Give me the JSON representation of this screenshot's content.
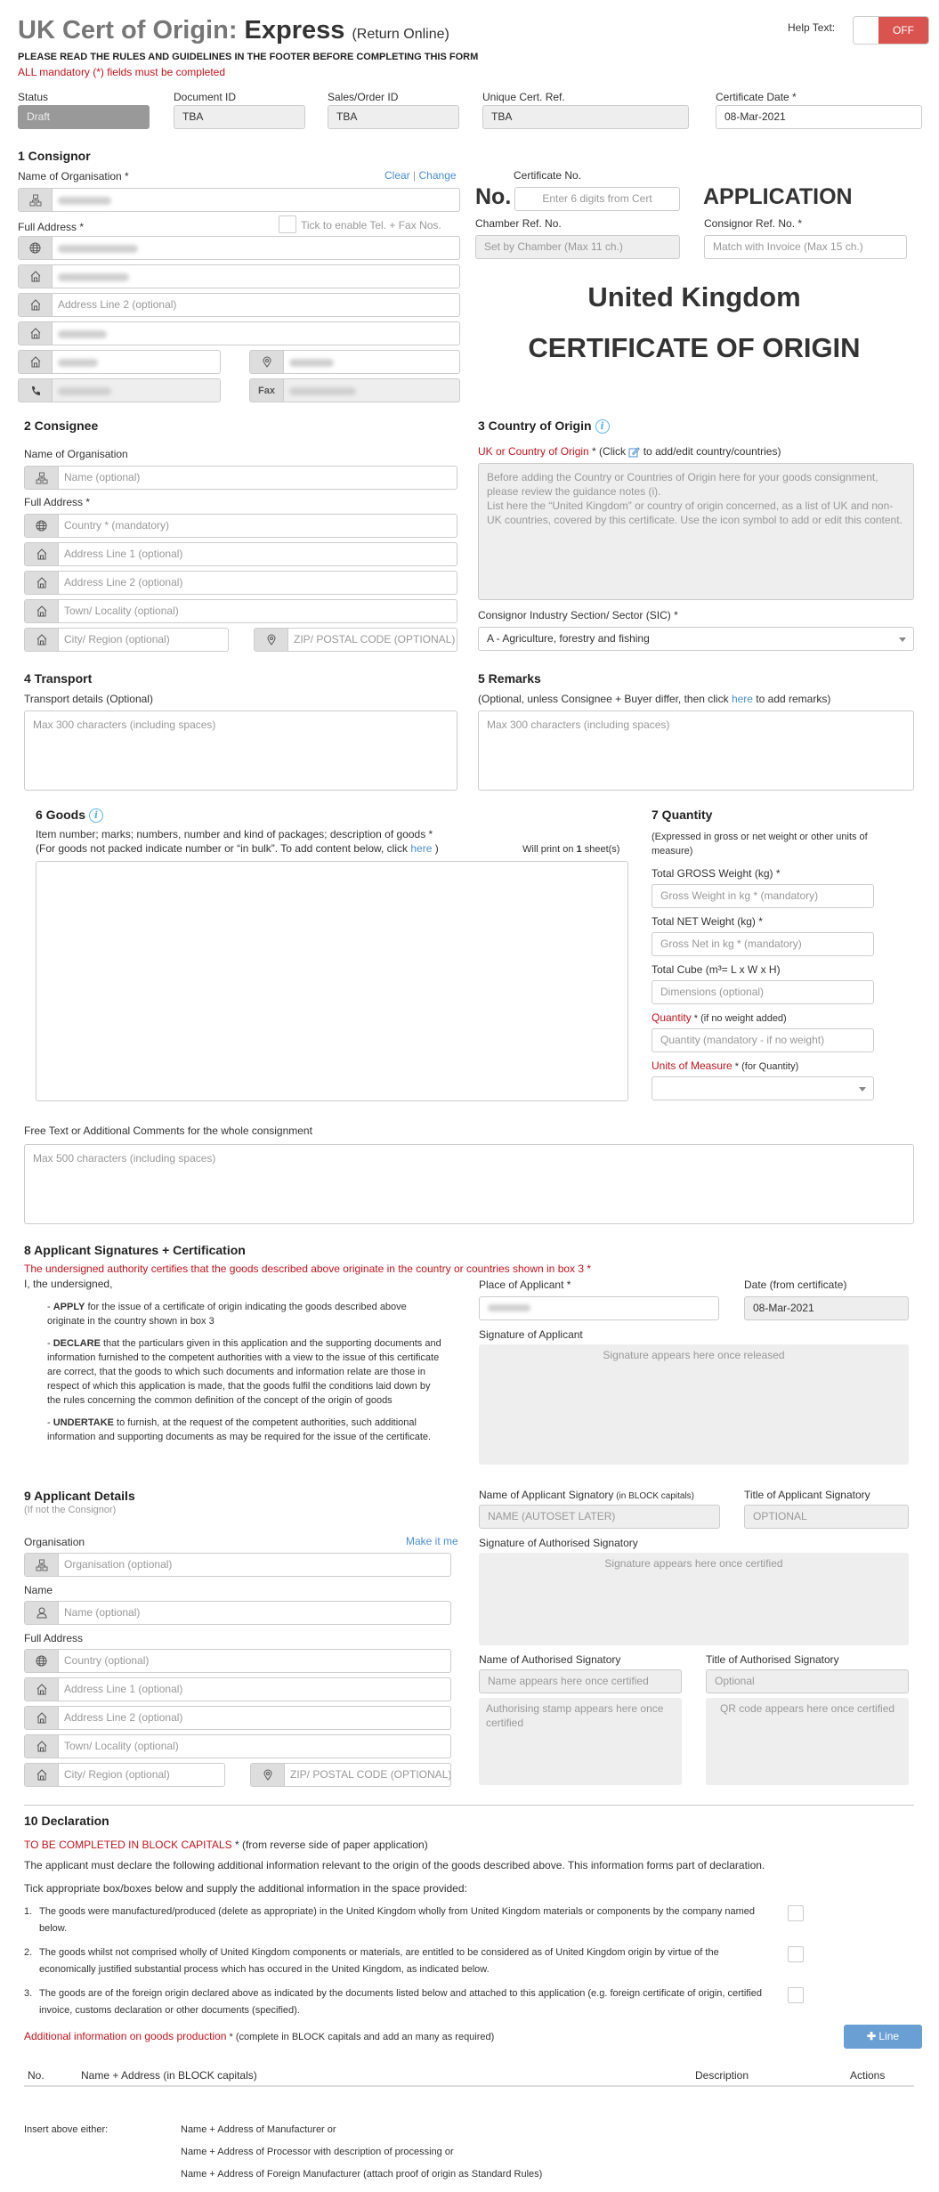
{
  "header": {
    "title_light": "UK Cert of Origin: ",
    "title_bold": "Express",
    "title_suffix": "(Return Online)",
    "notice": "PLEASE READ THE RULES AND GUIDELINES IN THE FOOTER BEFORE COMPLETING THIS FORM",
    "mandatory_note": "ALL mandatory (*) fields must be completed",
    "help_text_label": "Help Text:",
    "help_toggle_state": "OFF"
  },
  "meta_fields": [
    {
      "label": "Status",
      "value": "Draft"
    },
    {
      "label": "Document ID",
      "value": "TBA"
    },
    {
      "label": "Sales/Order ID",
      "value": "TBA"
    },
    {
      "label": "Unique Cert. Ref.",
      "value": "TBA"
    },
    {
      "label": "Certificate Date *",
      "value": "08-Mar-2021"
    }
  ],
  "consignor": {
    "heading": "1 Consignor",
    "org_label": "Name of Organisation *",
    "clear_link": "Clear",
    "separator": "|",
    "change_link": "Change",
    "address_label": "Full Address *",
    "tel_fax_checkbox_label": "Tick to enable Tel. + Fax Nos.",
    "address_line2_placeholder": "Address Line 2 (optional)",
    "fax_label": "Fax"
  },
  "certificate": {
    "cert_no_label": "Certificate No.",
    "no_prefix": "No.",
    "cert_no_placeholder": "Enter 6 digits from Cert",
    "application_heading": "APPLICATION",
    "chamber_ref_label": "Chamber Ref. No.",
    "chamber_ref_placeholder": "Set by Chamber (Max 11 ch.)",
    "consignor_ref_label": "Consignor Ref. No. *",
    "consignor_ref_placeholder": "Match with Invoice (Max 15 ch.)",
    "country_title": "United Kingdom",
    "doc_title": "CERTIFICATE OF ORIGIN"
  },
  "consignee": {
    "heading": "2 Consignee",
    "org_label": "Name of Organisation",
    "name_placeholder": "Name (optional)",
    "address_label": "Full Address *",
    "country_placeholder": "Country * (mandatory)",
    "addr1_placeholder": "Address Line 1 (optional)",
    "addr2_placeholder": "Address Line 2 (optional)",
    "town_placeholder": "Town/ Locality (optional)",
    "city_placeholder": "City/ Region (optional)",
    "zip_placeholder": "ZIP/ POSTAL CODE (OPTIONAL)"
  },
  "country_of_origin": {
    "heading": "3 Country of Origin",
    "label_red": "UK or Country of Origin",
    "label_rest_1": " * (Click ",
    "label_rest_2": " to add/edit country/countries)",
    "placeholder_p1": "Before adding the Country or Countries of Origin here for your goods consignment, please review the guidance notes (i).",
    "placeholder_p2": "List here the “United Kingdom” or country of origin concerned, as a list of UK and non-UK countries, covered by this certificate. Use the icon symbol to add or edit this content.",
    "sic_label": "Consignor Industry Section/ Sector (SIC) *",
    "sic_value": "A - Agriculture, forestry and fishing"
  },
  "transport": {
    "heading": "4 Transport",
    "label": "Transport details (Optional)",
    "placeholder": "Max 300 characters (including spaces)"
  },
  "remarks": {
    "heading": "5 Remarks",
    "label_1": "(Optional, unless Consignee + Buyer differ, then click ",
    "link": "here",
    "label_2": " to add remarks)",
    "placeholder": "Max 300 characters (including spaces)"
  },
  "goods": {
    "heading": "6 Goods",
    "label": "Item number; marks; numbers, number and kind of packages; description of goods *",
    "sublabel_1": "(For goods not packed indicate number or “in bulk”. To add content below, click ",
    "link": "here",
    "sublabel_2": " )",
    "print_prefix": "Will print on ",
    "print_sheets": "1",
    "print_suffix": " sheet(s)"
  },
  "quantity": {
    "heading": "7 Quantity",
    "note": "(Expressed in gross or net weight or other units of measure)",
    "gross_label": "Total GROSS Weight (kg) *",
    "gross_placeholder": "Gross Weight in kg * (mandatory)",
    "net_label": "Total NET Weight (kg) *",
    "net_placeholder": "Gross Net in kg * (mandatory)",
    "cube_label": "Total Cube (m³= L x W x H)",
    "cube_placeholder": "Dimensions (optional)",
    "qty_label_red": "Quantity",
    "qty_label_rest": " * (if no weight added)",
    "qty_placeholder": "Quantity (mandatory - if no weight)",
    "uom_label_red": "Units of Measure",
    "uom_label_rest": " * (for Quantity)",
    "uom_value": ""
  },
  "free_text": {
    "label": "Free Text or Additional Comments for the whole consignment",
    "placeholder": "Max 500 characters (including spaces)"
  },
  "certification": {
    "heading": "8 Applicant Signatures + Certification",
    "statement": "The undersigned authority certifies that the goods described above originate in the country or countries shown in box 3 *",
    "intro": "I, the undersigned,",
    "clauses": [
      {
        "keyword": "APPLY",
        "text": " for the issue of a certificate of origin indicating the goods described above originate in the country shown in box 3"
      },
      {
        "keyword": "DECLARE",
        "text": " that the particulars given in this application and the supporting documents and information furnished to the competent authorities with a view to the issue of this certificate are correct, that the goods to which such documents and information relate are those in respect of which this application is made, that the goods fulfil the conditions laid down by the rules concerning the common definition of the concept of the origin of goods"
      },
      {
        "keyword": "UNDERTAKE",
        "text": " to furnish, at the request of the competent authorities, such additional information and supporting documents as may be required for the issue of the certificate."
      }
    ],
    "place_label": "Place of Applicant *",
    "date_label": "Date (from certificate)",
    "date_value": "08-Mar-2021",
    "signature_label": "Signature of Applicant",
    "signature_placeholder": "Signature appears here once released"
  },
  "applicant": {
    "heading": "9 Applicant Details",
    "subheading": "(If not the Consignor)",
    "org_label": "Organisation",
    "make_it_me": "Make it me",
    "org_placeholder": "Organisation (optional)",
    "name_label": "Name",
    "name_placeholder": "Name (optional)",
    "address_label": "Full Address",
    "country_placeholder": "Country (optional)",
    "addr1_placeholder": "Address Line 1 (optional)",
    "addr2_placeholder": "Address Line 2 (optional)",
    "town_placeholder": "Town/ Locality (optional)",
    "city_placeholder": "City/ Region (optional)",
    "zip_placeholder": "ZIP/ POSTAL CODE (OPTIONAL)",
    "signatory_name_label": "Name of Applicant Signatory",
    "signatory_name_hint": " (in BLOCK capitals)",
    "signatory_name_placeholder": "NAME (AUTOSET LATER)",
    "signatory_title_label": "Title of Applicant Signatory",
    "signatory_title_placeholder": "OPTIONAL",
    "auth_signature_label": "Signature of Authorised Signatory",
    "auth_signature_placeholder": "Signature appears here once certified",
    "auth_name_label": "Name of Authorised Signatory",
    "auth_name_placeholder": "Name appears here once certified",
    "auth_title_label": "Title of Authorised Signatory",
    "auth_title_placeholder": "Optional",
    "stamp_placeholder": "Authorising stamp appears here once certified",
    "qr_placeholder": "QR code appears here once certified"
  },
  "declaration": {
    "heading": "10 Declaration",
    "block_caps_red": "TO BE COMPLETED IN BLOCK CAPITALS",
    "block_caps_rest": " * (from reverse side of paper application)",
    "intro": "The applicant must declare the following additional information relevant to the origin of the goods described above. This information forms part of declaration.",
    "tick_note": "Tick appropriate box/boxes below and supply the additional information in the space provided:",
    "items": [
      {
        "num": "1.",
        "text": "The goods were manufactured/produced (delete as appropriate) in the United Kingdom wholly from United Kingdom materials or components by the company named below."
      },
      {
        "num": "2.",
        "text": "The goods whilst not comprised wholly of United Kingdom components or materials, are entitled to be considered as of United Kingdom origin by virtue of the economically justified substantial process which has occured in the United Kingdom, as indicated below."
      },
      {
        "num": "3.",
        "text": "The goods are of the foreign origin declared above as indicated by the documents listed below and attached to this application (e.g. foreign certificate of origin, certified invoice, customs declaration or other documents (specified)."
      }
    ],
    "additional_red": "Additional information on goods production",
    "additional_rest": " * (complete in BLOCK capitals and add an many as required)",
    "add_line_button": "Line",
    "table_headers": [
      "No.",
      "Name + Address (in BLOCK capitals)",
      "Description",
      "Actions"
    ],
    "insert_label": "Insert above either:",
    "insert_options": [
      "Name + Address of Manufacturer or",
      "Name + Address of Processor with description of processing or",
      "Name + Address of Foreign Manufacturer (attach proof of origin as Standard Rules)"
    ]
  },
  "colors": {
    "accent_red": "#c0141c",
    "toggle_off": "#d9534f",
    "link_blue": "#4a8fd0",
    "button_blue": "#6a9fd4"
  }
}
